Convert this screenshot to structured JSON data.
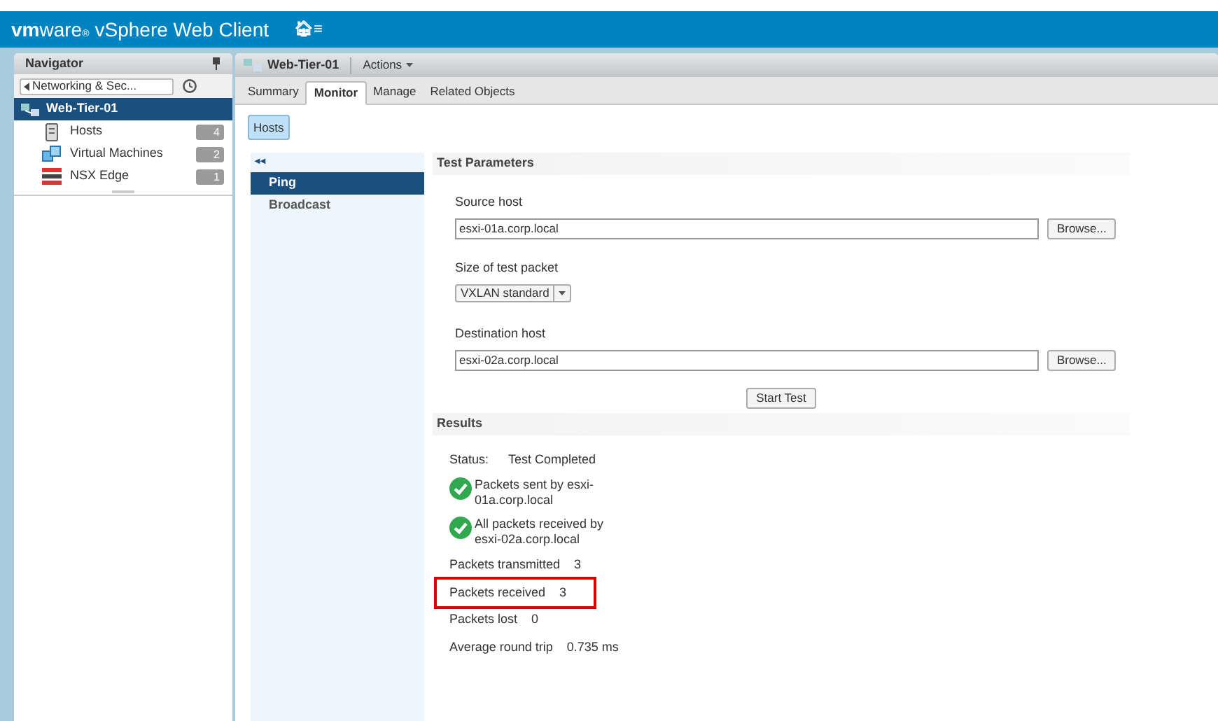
{
  "header": {
    "brand_bold": "vm",
    "brand_light": "ware",
    "brand_mark": "®",
    "product": "vSphere Web Client",
    "home_icon_text": "🏠︎≡"
  },
  "navigator": {
    "title": "Navigator",
    "breadcrumb": "Networking & Sec...",
    "root": {
      "label": "Web-Tier-01",
      "selected": true
    },
    "items": [
      {
        "kind": "host",
        "label": "Hosts",
        "count": "4"
      },
      {
        "kind": "vm",
        "label": "Virtual Machines",
        "count": "2"
      },
      {
        "kind": "edge",
        "label": "NSX Edge",
        "count": "1"
      }
    ]
  },
  "object": {
    "title": "Web-Tier-01",
    "actions": "Actions"
  },
  "tabs": [
    {
      "label": "Summary",
      "selected": false
    },
    {
      "label": "Monitor",
      "selected": true
    },
    {
      "label": "Manage",
      "selected": false
    },
    {
      "label": "Related Objects",
      "selected": false
    }
  ],
  "subtabs": [
    {
      "label": "Hosts",
      "selected": true
    }
  ],
  "side_menu": {
    "collapse": "◂◂",
    "items": [
      {
        "label": "Ping",
        "selected": true
      },
      {
        "label": "Broadcast",
        "selected": false
      }
    ]
  },
  "test_parameters": {
    "title": "Test Parameters",
    "source_label": "Source host",
    "source_value": "esxi-01a.corp.local",
    "browse1": "Browse...",
    "size_label": "Size of test packet",
    "size_value": "VXLAN standard",
    "dest_label": "Destination host",
    "dest_value": "esxi-02a.corp.local",
    "browse2": "Browse...",
    "start": "Start Test"
  },
  "results": {
    "title": "Results",
    "rows": [
      {
        "kind": "status",
        "label": "Status:",
        "value": "Test Completed",
        "highlighted": false
      },
      {
        "kind": "check",
        "label": "Packets sent by esxi-01a.corp.local",
        "highlighted": false
      },
      {
        "kind": "check",
        "label": "All packets received by esxi-02a.corp.local",
        "highlighted": false
      },
      {
        "kind": "stat",
        "label": "Packets transmitted",
        "value": "3",
        "highlighted": false
      },
      {
        "kind": "stat",
        "label": "Packets received",
        "value": "3",
        "highlighted": true
      },
      {
        "kind": "stat",
        "label": "Packets lost",
        "value": "0",
        "highlighted": false
      },
      {
        "kind": "stat",
        "label": "Average round trip",
        "value": "0.735 ms",
        "highlighted": false
      }
    ]
  }
}
